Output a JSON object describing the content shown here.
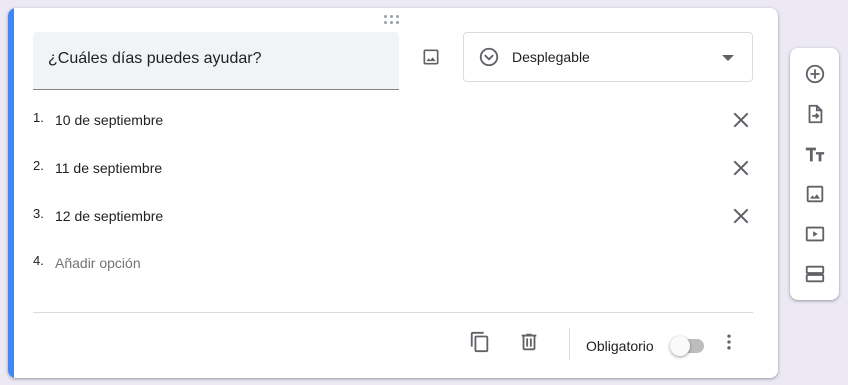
{
  "question": {
    "title": "¿Cuáles días puedes ayudar?"
  },
  "question_type": {
    "selected": "Desplegable",
    "icon": "chevron-circle-icon"
  },
  "options": [
    {
      "number": "1.",
      "label": "10 de septiembre"
    },
    {
      "number": "2.",
      "label": "11 de septiembre"
    },
    {
      "number": "3.",
      "label": "12 de septiembre"
    }
  ],
  "add_option": {
    "number": "4.",
    "label": "Añadir opción"
  },
  "footer": {
    "required_label": "Obligatorio",
    "required_on": false
  },
  "colors": {
    "accent": "#4285f4",
    "icon": "#5f6368",
    "background": "#ece9f5"
  },
  "sidebar": {
    "items": [
      "add-question-icon",
      "import-questions-icon",
      "add-title-icon",
      "add-image-icon",
      "add-video-icon",
      "add-section-icon"
    ]
  }
}
